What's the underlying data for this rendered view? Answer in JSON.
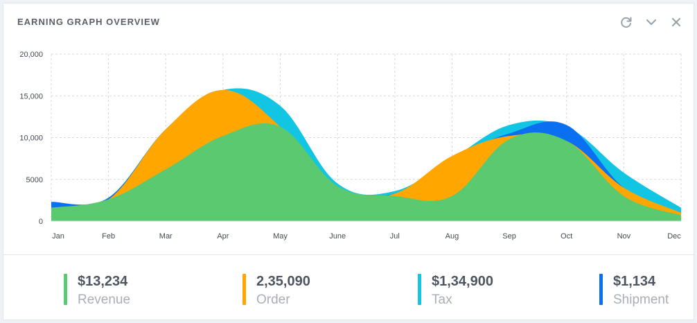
{
  "header": {
    "title": "EARNING GRAPH OVERVIEW",
    "refresh_icon": "refresh-icon",
    "collapse_icon": "chevron-down-icon",
    "close_icon": "close-icon"
  },
  "chart_data": {
    "type": "area",
    "categories": [
      "Jan",
      "Feb",
      "Mar",
      "Apr",
      "May",
      "June",
      "Jul",
      "Aug",
      "Sep",
      "Oct",
      "Nov",
      "Dec"
    ],
    "yticks": [
      "0",
      "5000",
      "10,000",
      "15,000",
      "20,000"
    ],
    "ylim": [
      0,
      20000
    ],
    "grid": true,
    "series": [
      {
        "name": "Revenue",
        "color": "#5ac96f",
        "values": [
          1600,
          2600,
          6200,
          10200,
          11300,
          4200,
          3000,
          3000,
          9800,
          9600,
          3000,
          700
        ]
      },
      {
        "name": "Order",
        "color": "#ffa600",
        "values": [
          1600,
          2600,
          11000,
          15700,
          11300,
          3500,
          3300,
          7800,
          10200,
          9600,
          4000,
          1000
        ]
      },
      {
        "name": "Tax",
        "color": "#12c5e2",
        "values": [
          1600,
          2800,
          11000,
          15700,
          13800,
          4500,
          3600,
          7500,
          11500,
          11300,
          5800,
          1600
        ]
      },
      {
        "name": "Shipment",
        "color": "#0a6ff0",
        "values": [
          2300,
          2800,
          11000,
          15700,
          11300,
          4000,
          3300,
          7500,
          10500,
          11500,
          4000,
          1000
        ]
      }
    ]
  },
  "stats": [
    {
      "value": "$13,234",
      "label": "Revenue",
      "color": "#5ac96f"
    },
    {
      "value": "2,35,090",
      "label": "Order",
      "color": "#ffa600"
    },
    {
      "value": "$1,34,900",
      "label": "Tax",
      "color": "#12c5e2"
    },
    {
      "value": "$1,134",
      "label": "Shipment",
      "color": "#0a6ff0"
    }
  ]
}
